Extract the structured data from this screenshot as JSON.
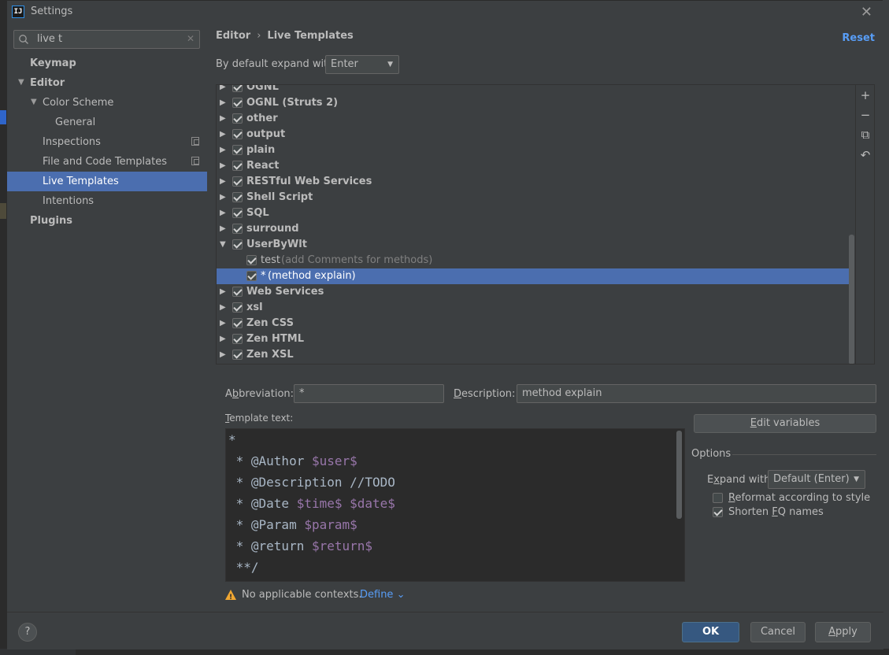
{
  "window": {
    "title": "Settings",
    "app_icon": "IJ"
  },
  "search": {
    "value": "live t"
  },
  "sidebar": {
    "items": [
      {
        "label": "Keymap"
      },
      {
        "label": "Editor"
      },
      {
        "label": "Color Scheme"
      },
      {
        "label": "General"
      },
      {
        "label": "Inspections"
      },
      {
        "label": "File and Code Templates"
      },
      {
        "label": "Live Templates"
      },
      {
        "label": "Intentions"
      },
      {
        "label": "Plugins"
      }
    ]
  },
  "header": {
    "breadcrumb_parent": "Editor",
    "breadcrumb_separator": "›",
    "breadcrumb_current": "Live Templates",
    "reset_label": "Reset"
  },
  "expand": {
    "label": "By default expand with",
    "value": "Enter"
  },
  "template_groups": [
    {
      "name": "OGNL"
    },
    {
      "name": "OGNL (Struts 2)"
    },
    {
      "name": "other"
    },
    {
      "name": "output"
    },
    {
      "name": "plain"
    },
    {
      "name": "React"
    },
    {
      "name": "RESTful Web Services"
    },
    {
      "name": "Shell Script"
    },
    {
      "name": "SQL"
    },
    {
      "name": "surround"
    },
    {
      "name": "UserByWlt"
    },
    {
      "name": "test",
      "desc": "(add Comments for methods)"
    },
    {
      "name": "*",
      "desc": "(method explain)"
    },
    {
      "name": "Web Services"
    },
    {
      "name": "xsl"
    },
    {
      "name": "Zen CSS"
    },
    {
      "name": "Zen HTML"
    },
    {
      "name": "Zen XSL"
    }
  ],
  "toolbar": {
    "add": "+",
    "remove": "−",
    "copy": "⧉",
    "revert": "↶"
  },
  "abbreviation": {
    "label_pre": "A",
    "label_u": "b",
    "label_post": "breviation:",
    "value": "*"
  },
  "description": {
    "label_u": "D",
    "label_post": "escription:",
    "value": "method explain"
  },
  "template_text": {
    "label_u": "T",
    "label_post": "emplate text:",
    "lines": [
      {
        "text": "*",
        "var": ""
      },
      {
        "text": " * @Author ",
        "var": "$user$"
      },
      {
        "text": " * @Description //TODO",
        "var": ""
      },
      {
        "text": " * @Date ",
        "var": "$time$ $date$"
      },
      {
        "text": " * @Param ",
        "var": "$param$"
      },
      {
        "text": " * @return ",
        "var": "$return$"
      },
      {
        "text": " **/",
        "var": ""
      }
    ]
  },
  "edit_variables": {
    "label_u": "E",
    "label_post": "dit variables"
  },
  "options": {
    "title": "Options",
    "expand_with_label_pre": "E",
    "expand_with_label_u": "x",
    "expand_with_label_post": "pand with",
    "expand_with_value": "Default (Enter)",
    "reformat_u": "R",
    "reformat_post": "eformat according to style",
    "shorten_pre": "Shorten ",
    "shorten_u": "F",
    "shorten_post": "Q names"
  },
  "warning": {
    "text": "No applicable contexts.",
    "define_label": "Define ⌄"
  },
  "buttons": {
    "help": "?",
    "ok": "OK",
    "cancel": "Cancel",
    "apply_u": "A",
    "apply_post": "pply"
  },
  "colors": {
    "background": "#3c3f41",
    "selection": "#4b6eaf",
    "link": "#589df6",
    "template_variable": "#9876aa",
    "editor_background": "#2b2b2b",
    "primary_button": "#365880"
  }
}
